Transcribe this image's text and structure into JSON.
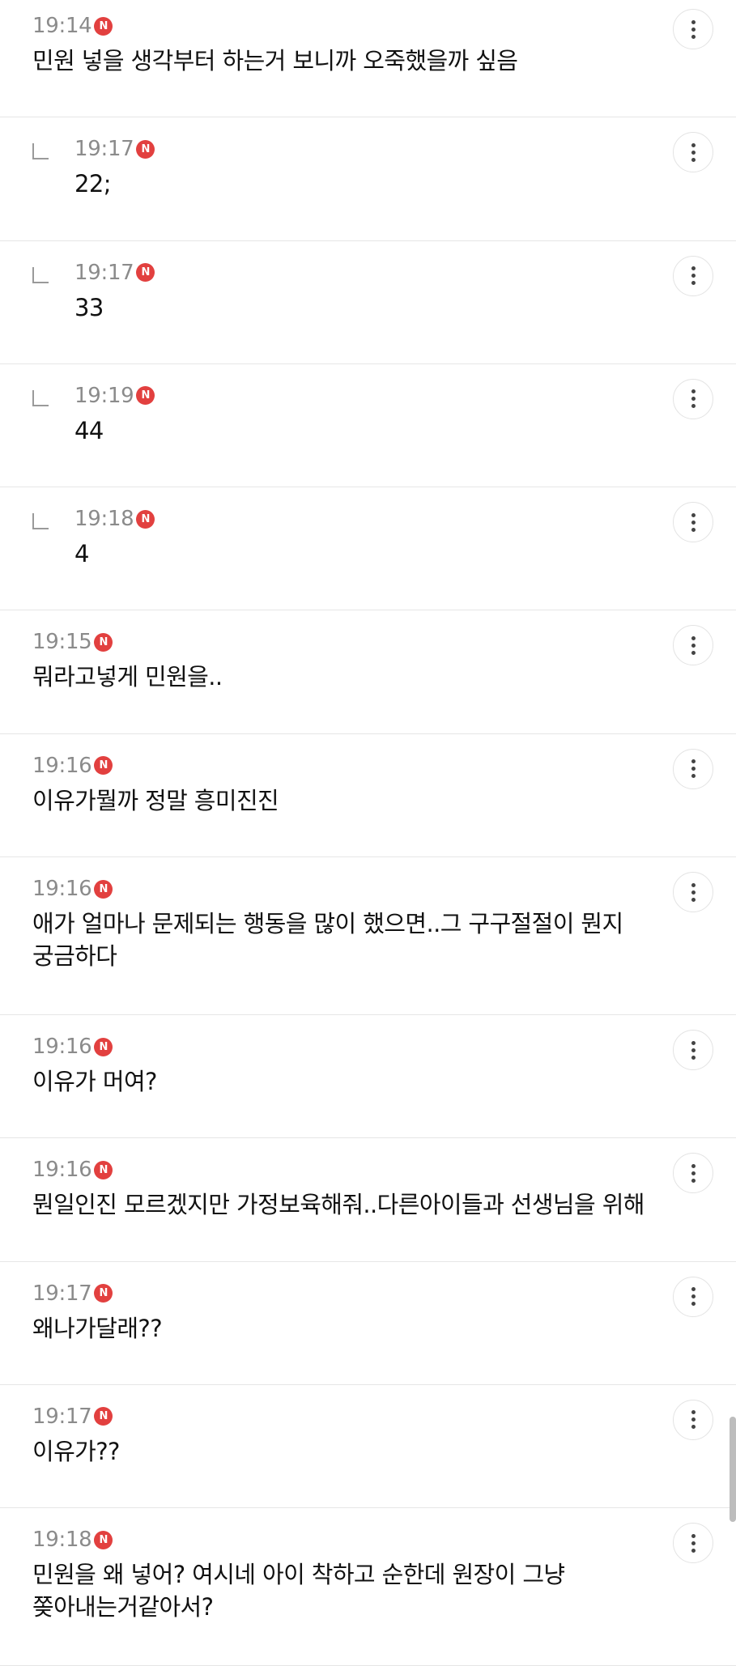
{
  "comments": [
    {
      "time": "19:14",
      "badge": "N",
      "text": "민원 넣을 생각부터 하는거 보니까 오죽했을까 싶음",
      "reply": false
    },
    {
      "time": "19:17",
      "badge": "N",
      "text": "22;",
      "reply": true
    },
    {
      "time": "19:17",
      "badge": "N",
      "text": "33",
      "reply": true
    },
    {
      "time": "19:19",
      "badge": "N",
      "text": "44",
      "reply": true
    },
    {
      "time": "19:18",
      "badge": "N",
      "text": "4",
      "reply": true
    },
    {
      "time": "19:15",
      "badge": "N",
      "text": "뭐라고넣게 민원을..",
      "reply": false
    },
    {
      "time": "19:16",
      "badge": "N",
      "text": "이유가뭘까 정말 흥미진진",
      "reply": false
    },
    {
      "time": "19:16",
      "badge": "N",
      "text": "애가 얼마나 문제되는 행동을 많이 했으면..그 구구절절이 뭔지\n궁금하다",
      "reply": false
    },
    {
      "time": "19:16",
      "badge": "N",
      "text": "이유가 머여?",
      "reply": false
    },
    {
      "time": "19:16",
      "badge": "N",
      "text": "뭔일인진 모르겠지만 가정보육해줘..다른아이들과 선생님을 위해",
      "reply": false
    },
    {
      "time": "19:17",
      "badge": "N",
      "text": "왜나가달래??",
      "reply": false
    },
    {
      "time": "19:17",
      "badge": "N",
      "text": "이유가??",
      "reply": false
    },
    {
      "time": "19:18",
      "badge": "N",
      "text": "민원을 왜 넣어? 여시네 아이 착하고 순한데 원장이 그냥\n쫒아내는거같아서?",
      "reply": false
    }
  ]
}
